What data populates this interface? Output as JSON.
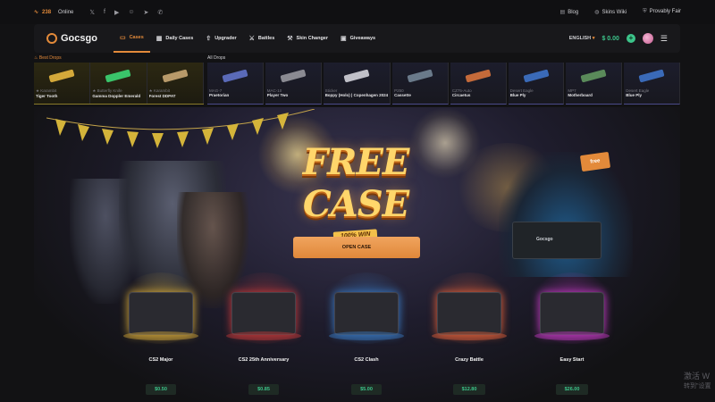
{
  "topbar": {
    "online_count": "238",
    "online_label": "Online",
    "socials": [
      "x-icon",
      "facebook-icon",
      "youtube-icon",
      "discord-icon",
      "telegram-icon",
      "whatsapp-icon"
    ],
    "links": [
      {
        "label": "Blog",
        "icon": "document-icon"
      },
      {
        "label": "Skins Wiki",
        "icon": "globe-icon"
      },
      {
        "label": "Provably Fair",
        "icon": "shield-icon"
      }
    ]
  },
  "nav": {
    "logo": "Gocsgo",
    "items": [
      {
        "label": "Cases",
        "icon": "case-icon",
        "active": true
      },
      {
        "label": "Daily Cases",
        "icon": "calendar-icon",
        "active": false
      },
      {
        "label": "Upgrader",
        "icon": "upgrade-icon",
        "active": false
      },
      {
        "label": "Battles",
        "icon": "swords-icon",
        "active": false
      },
      {
        "label": "Skin Changer",
        "icon": "wrench-icon",
        "active": false
      },
      {
        "label": "Giveaways",
        "icon": "gift-icon",
        "active": false
      }
    ],
    "language": "ENGLISH",
    "balance": "$ 0.00"
  },
  "drops": {
    "best_label": "Best Drops",
    "all_label": "All Drops",
    "best": [
      {
        "category": "★ Karambit",
        "name": "Tiger Tooth",
        "color": "#d4a93a"
      },
      {
        "category": "★ Butterfly Knife",
        "name": "Gamma Doppler Emerald",
        "color": "#3ac46a"
      },
      {
        "category": "★ Karambit",
        "name": "Forest DDPAT",
        "color": "#b89a6a"
      }
    ],
    "all": [
      {
        "category": "MAG-7",
        "name": "Praetorian",
        "color": "#5a6ab8"
      },
      {
        "category": "MAC-10",
        "name": "Player Two",
        "color": "#8a8a92"
      },
      {
        "category": "Sticker",
        "name": "Boppy (Holo) | Copenhagen 2024",
        "color": "#c0c0c8"
      },
      {
        "category": "P250",
        "name": "Cassette",
        "color": "#6a7a8a"
      },
      {
        "category": "CZ75-Auto",
        "name": "Circaetus",
        "color": "#c46a3a"
      },
      {
        "category": "Desert Eagle",
        "name": "Blue Ply",
        "color": "#3a6ab8"
      },
      {
        "category": "MP7",
        "name": "Motherboard",
        "color": "#5a8a5a"
      },
      {
        "category": "Desert Eagle",
        "name": "Blue Ply",
        "color": "#3a6ab8"
      }
    ]
  },
  "hero": {
    "title": "FREE CASE",
    "ribbon": "100% WIN",
    "free_badge": "free",
    "case_label": "Gocsgo",
    "open_button": "OPEN CASE"
  },
  "cases": [
    {
      "name": "CS2 Major",
      "price": "$0.50",
      "glow": "#d4a93a"
    },
    {
      "name": "CS2 25th Anniversary",
      "price": "$0.85",
      "glow": "#c43a3a"
    },
    {
      "name": "CS2 Clash",
      "price": "$5.00",
      "glow": "#3a7ac4"
    },
    {
      "name": "Crazy Battle",
      "price": "$12.80",
      "glow": "#e0603a"
    },
    {
      "name": "Easy Start",
      "price": "$26.00",
      "glow": "#c43ac4"
    }
  ],
  "watermark": {
    "line1": "激活 W",
    "line2": "转到\"设置"
  }
}
